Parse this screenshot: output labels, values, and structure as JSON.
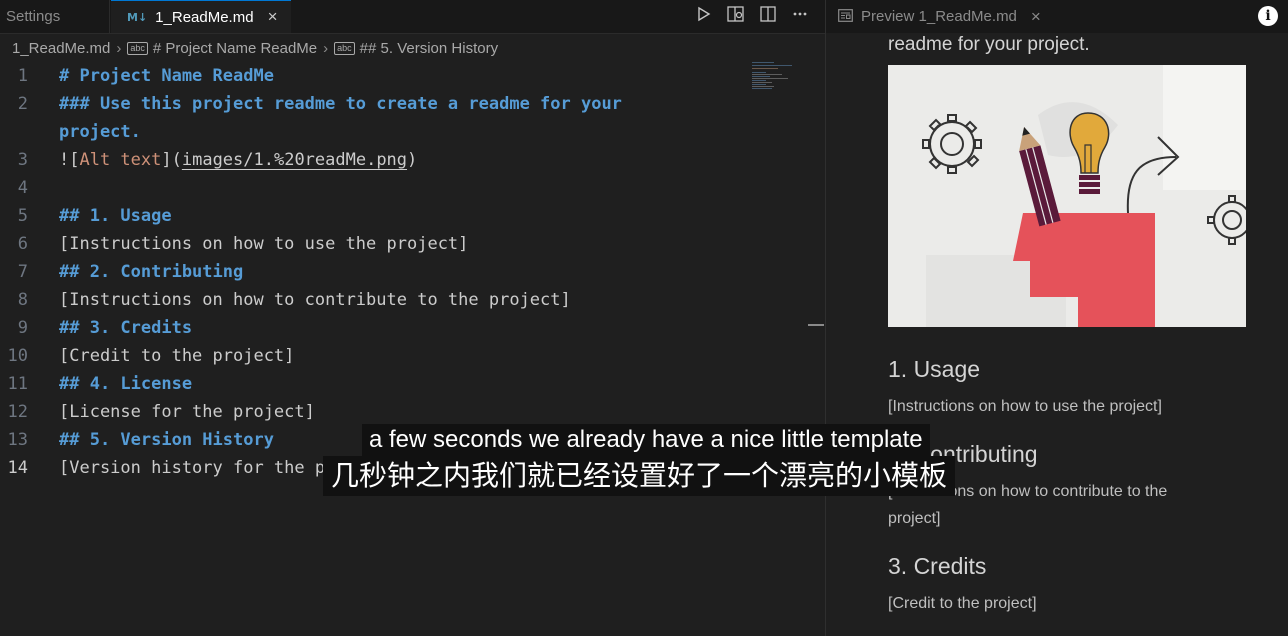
{
  "tabs": {
    "settings_label": "Settings",
    "readme_badge": "M↓",
    "readme_label": "1_ReadMe.md",
    "close_glyph": "×"
  },
  "toolbar": {
    "run_icon": "play-icon",
    "preview_side_icon": "open-preview-to-side-icon",
    "split_icon": "split-editor-icon",
    "more_icon": "more-actions-icon"
  },
  "breadcrumb": {
    "file": "1_ReadMe.md",
    "item1": "# Project Name ReadMe",
    "item2": "## 5. Version History",
    "abc_label": "abc"
  },
  "editor": {
    "line_numbers": [
      "1",
      "2",
      "",
      "3",
      "4",
      "5",
      "6",
      "7",
      "8",
      "9",
      "10",
      "11",
      "12",
      "13",
      "14"
    ],
    "lines": {
      "l1": "# Project Name ReadMe",
      "l2a": "### Use this project readme to create a readme for your",
      "l2b": "project.",
      "l3_prefix": "![",
      "l3_alt": "Alt text",
      "l3_mid": "](",
      "l3_link": "images/1.%20readMe.png",
      "l3_suffix": ")",
      "l5": "## 1. Usage",
      "l6": "[Instructions on how to use the project]",
      "l7": "## 2. Contributing",
      "l8": "[Instructions on how to contribute to the project]",
      "l9": "## 3. Credits",
      "l10": "[Credit to the project]",
      "l11": "## 4. License",
      "l12": "[License for the project]",
      "l13": "## 5. Version History",
      "l14": "[Version history for the project]"
    }
  },
  "preview": {
    "tab_label": "Preview 1_ReadMe.md",
    "h3_tail": "readme for your project.",
    "usage_heading": "1. Usage",
    "usage_text": "[Instructions on how to use the project]",
    "contrib_heading": "2. Contributing",
    "contrib_text_1": "[Instructions on how to contribute to the",
    "contrib_text_2": "project]",
    "credits_heading": "3. Credits",
    "credits_text": "[Credit to the project]"
  },
  "subtitles": {
    "english": "a few seconds we already have a nice little template",
    "chinese": "几秒钟之内我们就已经设置好了一个漂亮的小模板"
  },
  "colors": {
    "heading_blue": "#569cd6",
    "alt_text_orange": "#ce9178",
    "accent_tab": "#0078d4",
    "hero_red": "#e5525a"
  }
}
